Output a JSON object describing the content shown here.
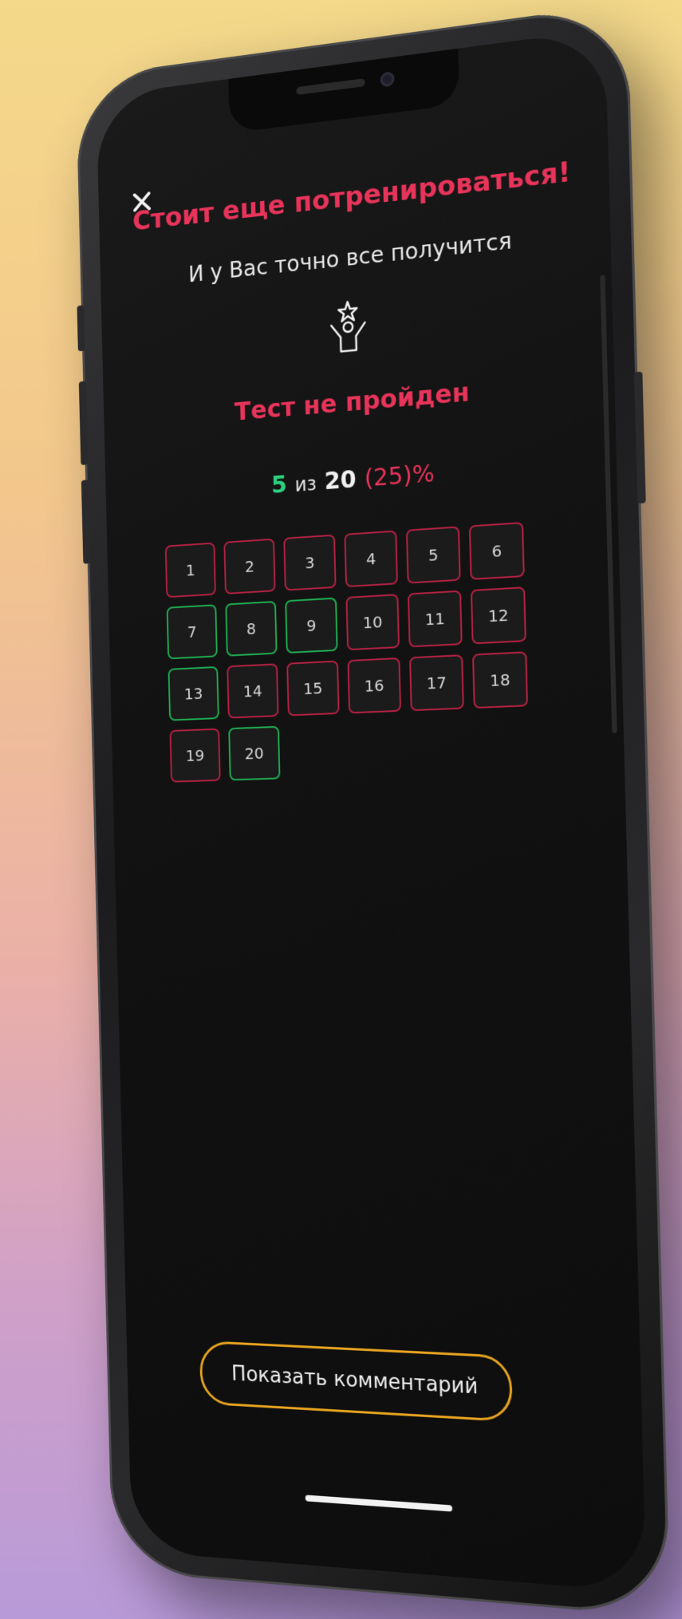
{
  "header": {
    "title": "Стоит еще потренироваться!",
    "subtitle": "И у Вас точно все получится",
    "icon": "person-star-icon"
  },
  "result": {
    "status": "Тест не пройден",
    "correct": "5",
    "of_label": "из",
    "total": "20",
    "percent": "(25)%"
  },
  "questions": [
    {
      "n": "1",
      "status": "wrong"
    },
    {
      "n": "2",
      "status": "wrong"
    },
    {
      "n": "3",
      "status": "wrong"
    },
    {
      "n": "4",
      "status": "wrong"
    },
    {
      "n": "5",
      "status": "wrong"
    },
    {
      "n": "6",
      "status": "wrong"
    },
    {
      "n": "7",
      "status": "right"
    },
    {
      "n": "8",
      "status": "right"
    },
    {
      "n": "9",
      "status": "right"
    },
    {
      "n": "10",
      "status": "wrong"
    },
    {
      "n": "11",
      "status": "wrong"
    },
    {
      "n": "12",
      "status": "wrong"
    },
    {
      "n": "13",
      "status": "right"
    },
    {
      "n": "14",
      "status": "wrong"
    },
    {
      "n": "15",
      "status": "wrong"
    },
    {
      "n": "16",
      "status": "wrong"
    },
    {
      "n": "17",
      "status": "wrong"
    },
    {
      "n": "18",
      "status": "wrong"
    },
    {
      "n": "19",
      "status": "wrong"
    },
    {
      "n": "20",
      "status": "right"
    }
  ],
  "footer": {
    "comment_button": "Показать комментарий"
  },
  "colors": {
    "accent_red": "#e8345a",
    "accent_green": "#2bd17e",
    "button_border": "#e8a420",
    "background": "#121212"
  }
}
